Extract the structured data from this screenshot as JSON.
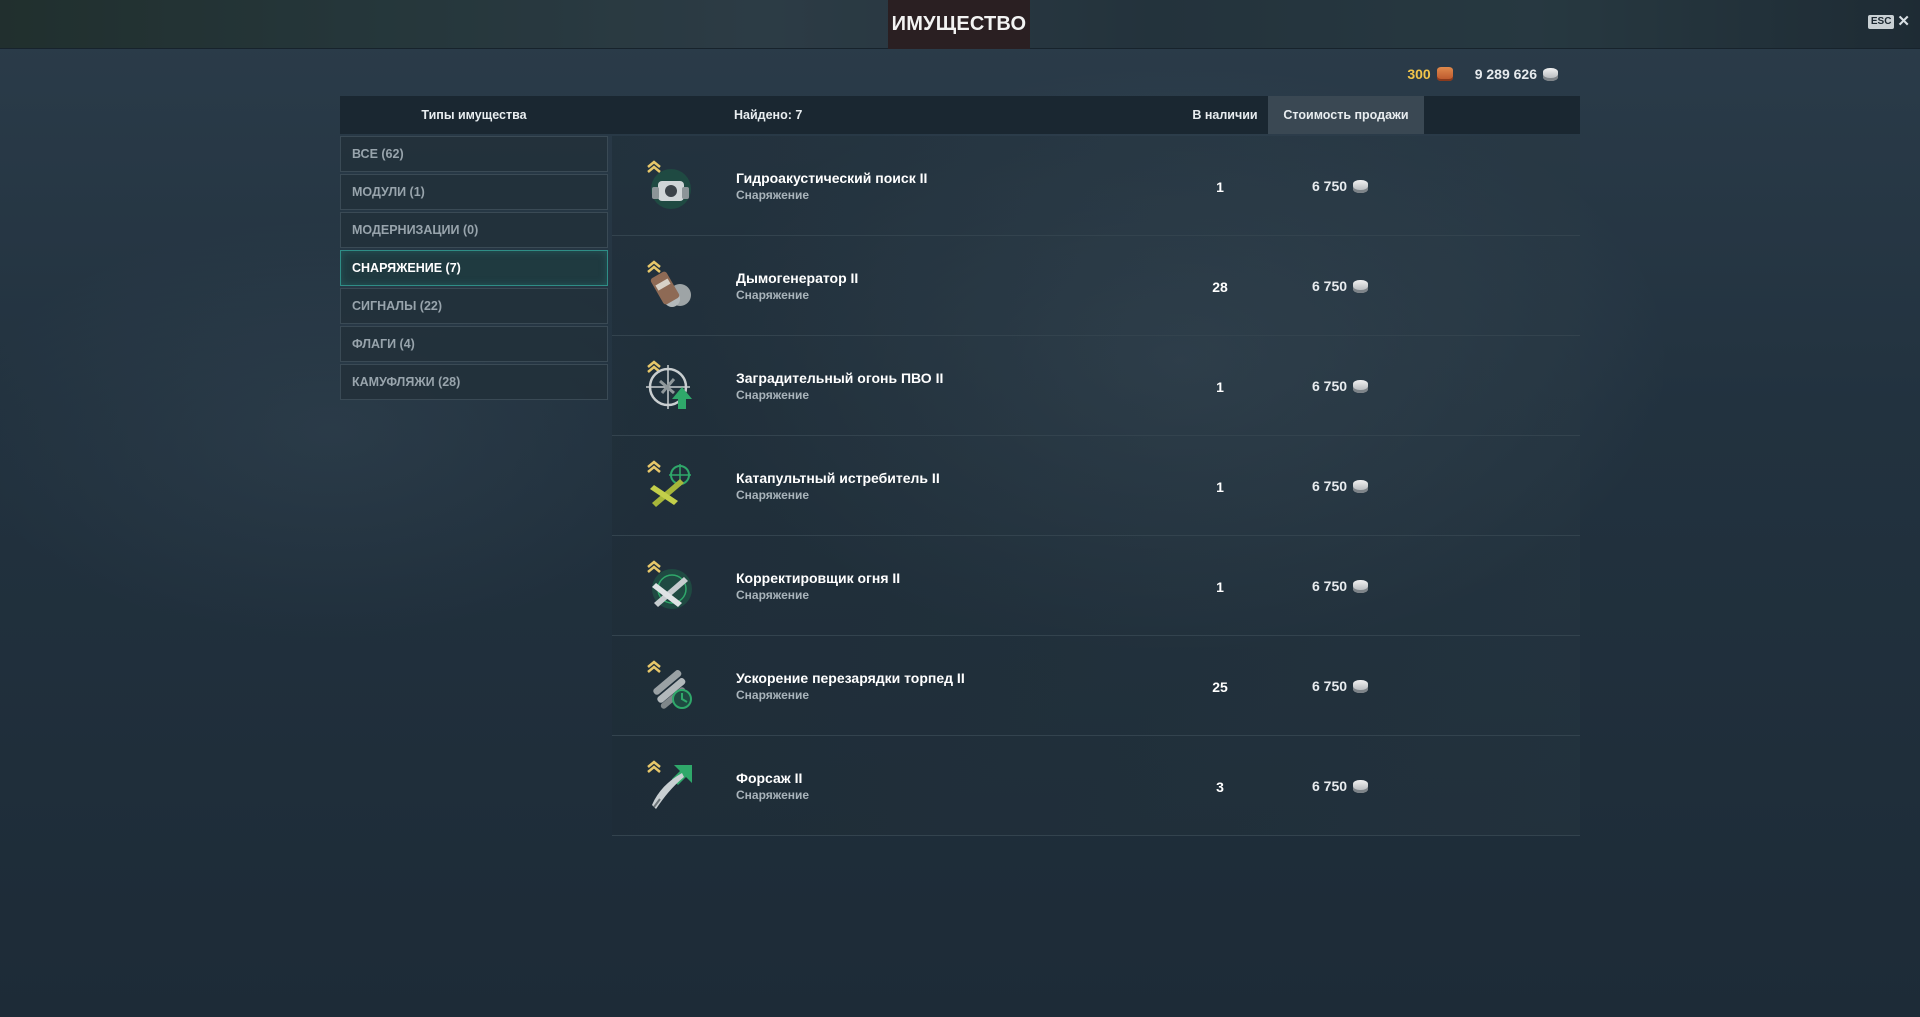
{
  "window": {
    "title": "ИМУЩЕСТВО",
    "esc_label": "ESC",
    "close_glyph": "✕"
  },
  "currency": {
    "doubloons": "300",
    "credits": "9 289 626"
  },
  "header": {
    "types": "Типы имущества",
    "found": "Найдено: 7",
    "in_stock": "В наличии",
    "sale_price": "Стоимость продажи"
  },
  "sidebar": {
    "items": [
      {
        "label": "ВСЕ (62)",
        "active": false
      },
      {
        "label": "МОДУЛИ (1)",
        "active": false
      },
      {
        "label": "МОДЕРНИЗАЦИИ (0)",
        "active": false
      },
      {
        "label": "СНАРЯЖЕНИЕ (7)",
        "active": true
      },
      {
        "label": "СИГНАЛЫ (22)",
        "active": false
      },
      {
        "label": "ФЛАГИ (4)",
        "active": false
      },
      {
        "label": "КАМУФЛЯЖИ (28)",
        "active": false
      }
    ]
  },
  "items": [
    {
      "name": "Гидроакустический поиск II",
      "category": "Снаряжение",
      "qty": "1",
      "price": "6 750",
      "icon": "hydroacoustic-search-icon"
    },
    {
      "name": "Дымогенератор II",
      "category": "Снаряжение",
      "qty": "28",
      "price": "6 750",
      "icon": "smoke-generator-icon"
    },
    {
      "name": "Заградительный огонь ПВО II",
      "category": "Снаряжение",
      "qty": "1",
      "price": "6 750",
      "icon": "defensive-aa-fire-icon"
    },
    {
      "name": "Катапультный истребитель II",
      "category": "Снаряжение",
      "qty": "1",
      "price": "6 750",
      "icon": "catapult-fighter-icon"
    },
    {
      "name": "Корректировщик огня II",
      "category": "Снаряжение",
      "qty": "1",
      "price": "6 750",
      "icon": "spotting-aircraft-icon"
    },
    {
      "name": "Ускорение перезарядки торпед II",
      "category": "Снаряжение",
      "qty": "25",
      "price": "6 750",
      "icon": "torpedo-reload-booster-icon"
    },
    {
      "name": "Форсаж II",
      "category": "Снаряжение",
      "qty": "3",
      "price": "6 750",
      "icon": "engine-boost-icon"
    }
  ]
}
